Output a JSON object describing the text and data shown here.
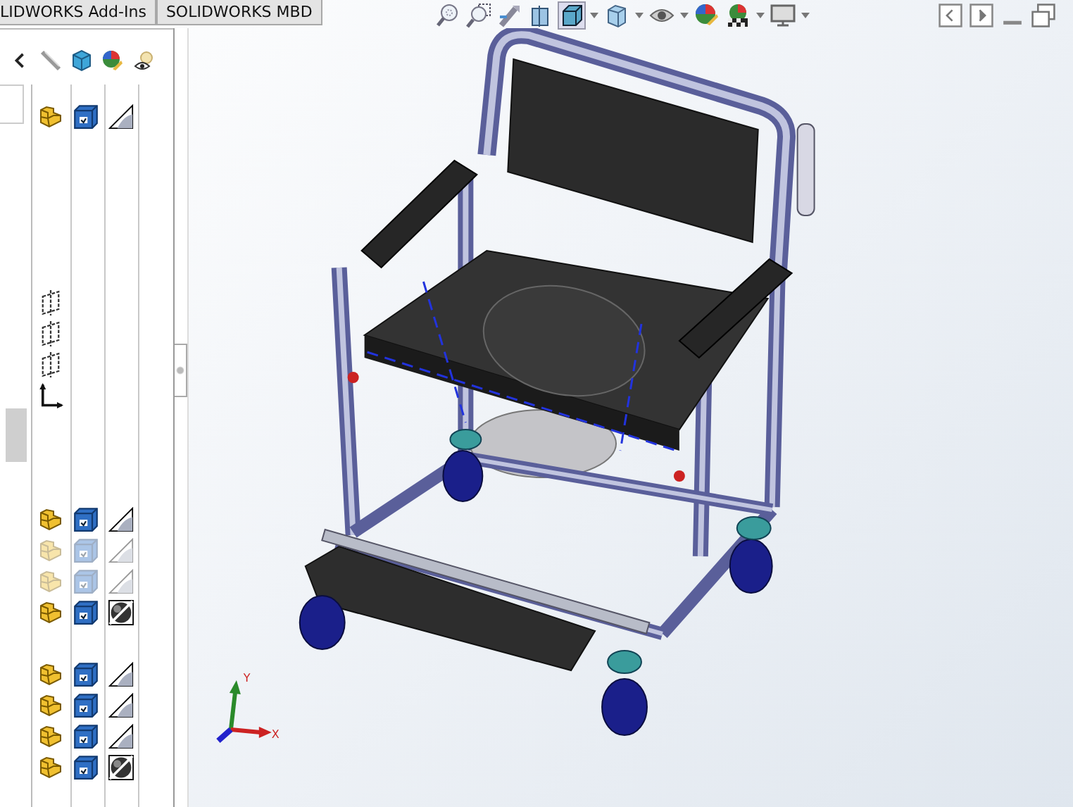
{
  "tabs": [
    {
      "label": "LIDWORKS Add-Ins",
      "selected": false
    },
    {
      "label": "SOLIDWORKS MBD",
      "selected": false
    }
  ],
  "display_pane": {
    "rows": [
      {
        "kind": "component",
        "faded": false,
        "dark": false
      },
      {
        "kind": "empty"
      },
      {
        "kind": "empty"
      },
      {
        "kind": "empty"
      },
      {
        "kind": "empty"
      },
      {
        "kind": "empty"
      },
      {
        "kind": "plane"
      },
      {
        "kind": "plane"
      },
      {
        "kind": "plane"
      },
      {
        "kind": "origin"
      },
      {
        "kind": "empty"
      },
      {
        "kind": "empty"
      },
      {
        "kind": "empty"
      },
      {
        "kind": "component",
        "faded": false,
        "dark": false
      },
      {
        "kind": "component",
        "faded": true,
        "dark": false
      },
      {
        "kind": "component",
        "faded": true,
        "dark": false
      },
      {
        "kind": "component",
        "faded": false,
        "dark": true
      },
      {
        "kind": "empty"
      },
      {
        "kind": "component",
        "faded": false,
        "dark": false
      },
      {
        "kind": "component",
        "faded": false,
        "dark": false
      },
      {
        "kind": "component",
        "faded": false,
        "dark": false
      },
      {
        "kind": "component",
        "faded": false,
        "dark": true
      }
    ]
  },
  "triad": {
    "y_label": "Y",
    "x_label": "X"
  }
}
